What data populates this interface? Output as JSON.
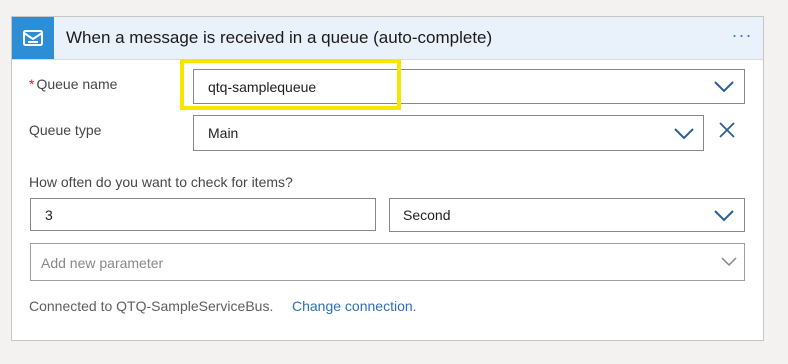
{
  "header": {
    "title": "When a message is received in a queue (auto-complete)",
    "icon": "service-bus-icon",
    "more_label": "···"
  },
  "queue_name": {
    "required_mark": "*",
    "label": "Queue name",
    "value": "qtq-samplequeue"
  },
  "queue_type": {
    "label": "Queue type",
    "value": "Main"
  },
  "interval": {
    "label": "How often do you want to check for items?",
    "count": "3",
    "unit": "Second"
  },
  "add_parameter": {
    "placeholder": "Add new parameter"
  },
  "footer": {
    "connected_text": "Connected to QTQ-SampleServiceBus.",
    "change_link": "Change connection."
  },
  "colors": {
    "accent": "#2d8ed6",
    "highlight": "#f7e600",
    "link": "#2e6fb5",
    "required": "#e81123"
  }
}
